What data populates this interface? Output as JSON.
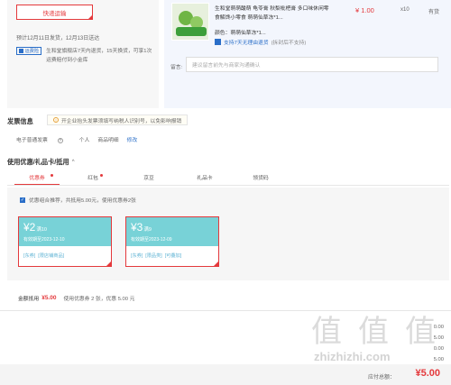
{
  "shipping": {
    "express_button": "快递运输",
    "date_text": "预计12月11日发货，12月13日送达",
    "store_badge": "运费险",
    "store_desc": "生和堂旗舰店7天内退货，15天换货，可享1次运费赔付到小金库"
  },
  "product": {
    "title": "生和堂萌萌酸萌 龟苓膏 秋梨枇杷膏 多口味休闲零食解馋小零食 萌萌仙草冻*1...",
    "price": "¥ 1.00",
    "qty": "x10",
    "stock": "有货",
    "color": "颜色：萌萌仙草冻*1...",
    "return_text": "支持7天无理由退货",
    "return_note": "(拆封后不支持)",
    "message_label": "留言:",
    "message_placeholder": "建议留言前先与商家沟通确认"
  },
  "invoice": {
    "title": "发票信息",
    "notice": "开企业抬头发票须填写纳税人识别号，以免影响报销",
    "type": "电子普通发票",
    "personal": "个人",
    "detail": "商品明细",
    "edit": "修改"
  },
  "coupons": {
    "title": "使用优惠/礼品卡/抵用",
    "tabs": [
      {
        "label": "优惠券",
        "dot": true
      },
      {
        "label": "红包",
        "dot": true
      },
      {
        "label": "京豆",
        "dot": false
      },
      {
        "label": "礼品卡",
        "dot": false
      },
      {
        "label": "领货码",
        "dot": false
      }
    ],
    "check_text": "优惠组合推荐，共抵用5.00元，使用优惠券2张",
    "items": [
      {
        "amount": "¥2",
        "cond": "满10",
        "valid": "有效期至2023-12-10",
        "tags": [
          "[东券]",
          "[限店铺商品]"
        ]
      },
      {
        "amount": "¥3",
        "cond": "满9",
        "valid": "有效期至2023-12-09",
        "tags": [
          "[东券]",
          "[限品类]",
          "[可叠加]"
        ]
      }
    ],
    "sum_label": "金额抵用",
    "sum_value": "¥5.00",
    "sum_note": "使用优惠券 2 张，优惠 5.00 元"
  },
  "summary": {
    "lines": [
      "0.00",
      "5.00",
      "0.00",
      "5.00"
    ],
    "pay_label": "应付总额：",
    "pay_amount": "¥5.00"
  },
  "watermark": {
    "glyph": "值",
    "text": "zhizhizhi.com"
  }
}
